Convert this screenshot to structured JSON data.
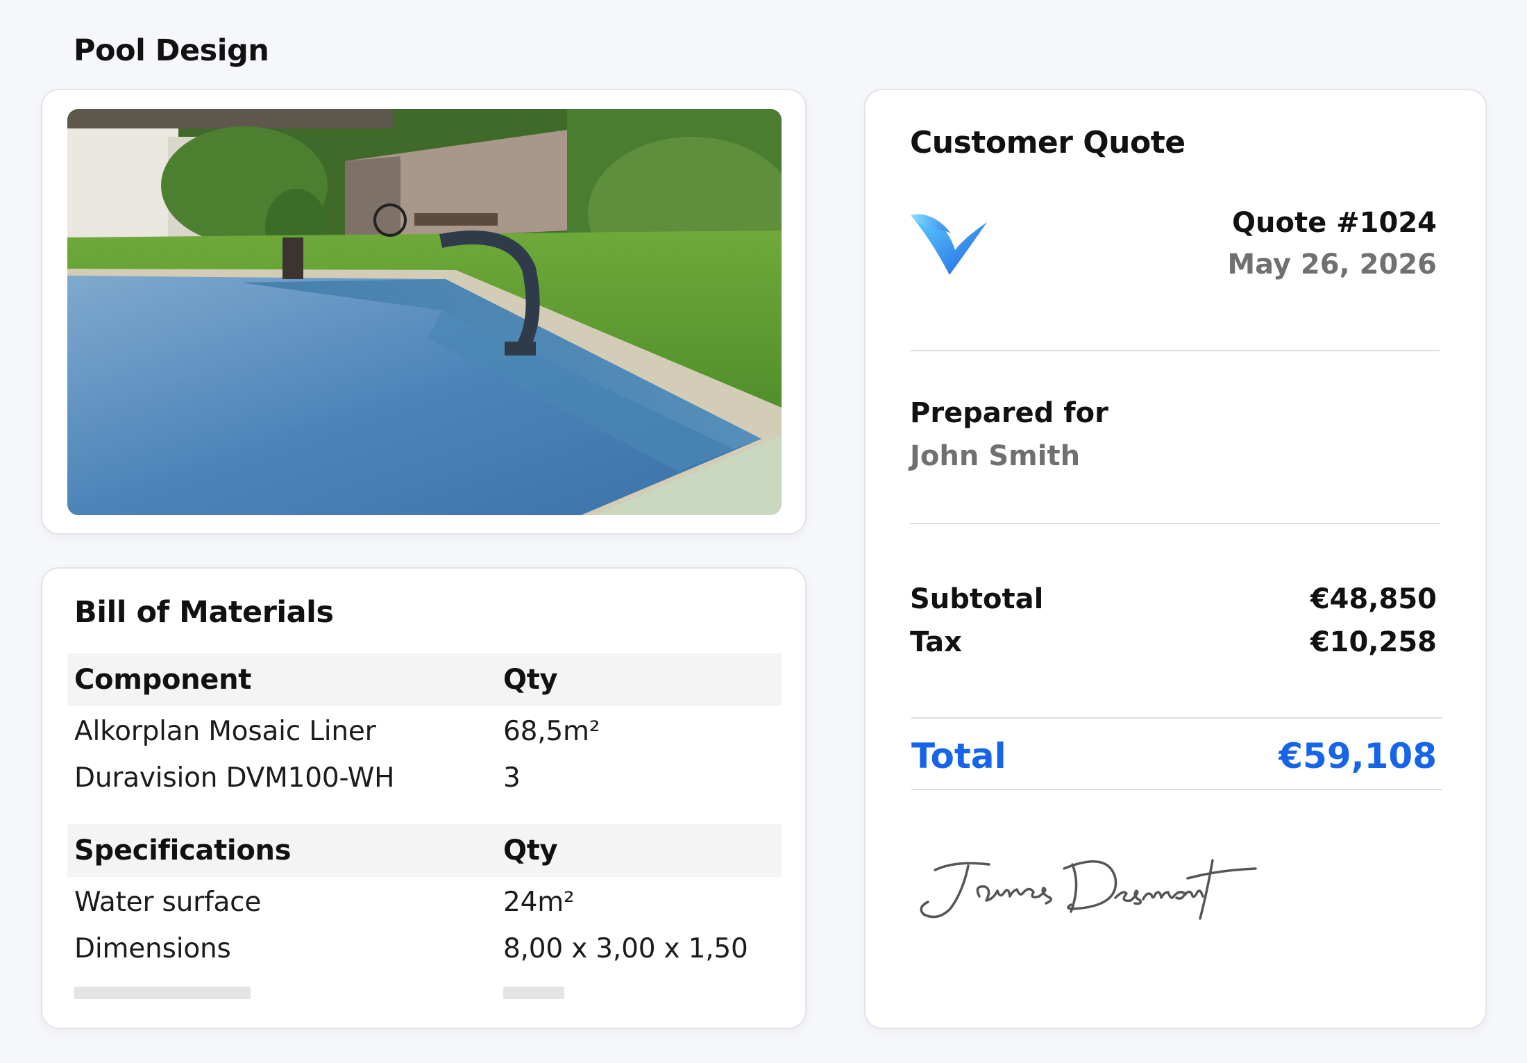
{
  "pool_design": {
    "title": "Pool Design"
  },
  "bill_of_materials": {
    "title": "Bill of Materials",
    "components_header": {
      "col1": "Component",
      "col2": "Qty"
    },
    "components": [
      {
        "name": "Alkorplan Mosaic Liner",
        "qty": "68,5m²"
      },
      {
        "name": "Duravision DVM100-WH",
        "qty": "3"
      }
    ],
    "specs_header": {
      "col1": "Specifications",
      "col2": "Qty"
    },
    "specs": [
      {
        "name": "Water surface",
        "qty": "24m²"
      },
      {
        "name": "Dimensions",
        "qty": "8,00 x 3,00 x 1,50"
      }
    ]
  },
  "quote": {
    "title": "Customer Quote",
    "logo_icon": "checkmark-wave-logo",
    "number": "Quote #1024",
    "date": "May 26, 2026",
    "prepared_for_label": "Prepared for",
    "customer_name": "John Smith",
    "subtotal_label": "Subtotal",
    "subtotal_value": "€48,850",
    "tax_label": "Tax",
    "tax_value": "€10,258",
    "total_label": "Total",
    "total_value": "€59,108",
    "signature_name": "James Desmont"
  },
  "colors": {
    "accent": "#1664e8",
    "muted_text": "#707070",
    "page_bg": "#f6f7fb"
  }
}
